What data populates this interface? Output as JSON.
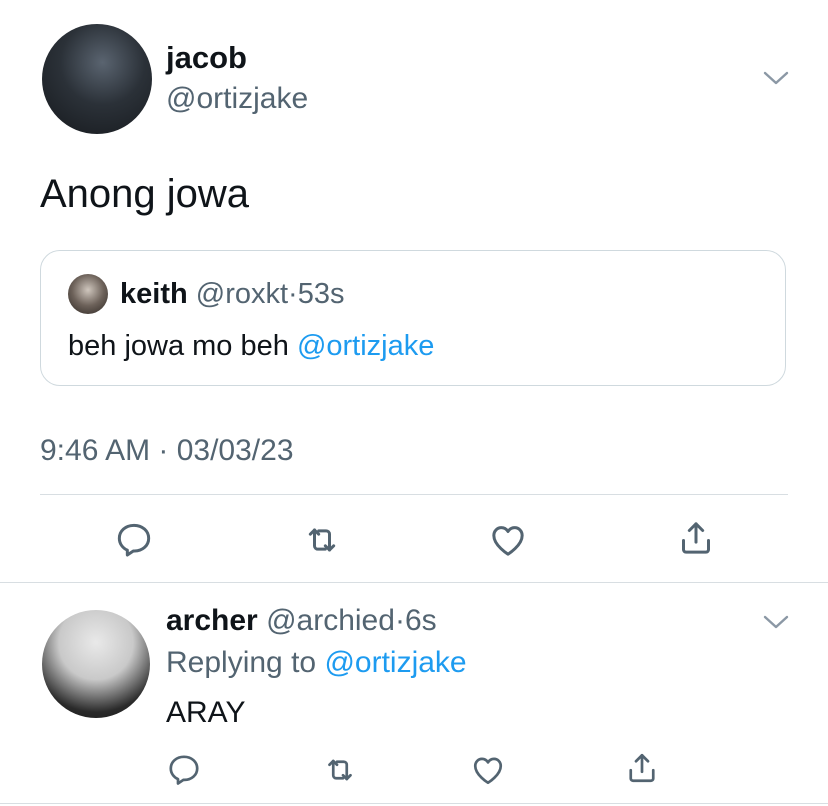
{
  "tweet": {
    "display_name": "jacob",
    "handle": "@ortizjake",
    "text": "Anong jowa",
    "timestamp": "9:46 AM · 03/03/23",
    "quote": {
      "display_name": "keith",
      "handle": "@roxkt",
      "dot": "·",
      "age": "53s",
      "text": "beh jowa mo beh",
      "mention": "@ortizjake"
    }
  },
  "reply": {
    "display_name": "archer",
    "handle": "@archied",
    "dot": "·",
    "age": "6s",
    "replying_to_label": "Replying to",
    "replying_to_handle": "@ortizjake",
    "text": "ARAY"
  },
  "icons": {
    "more": "chevron-down-icon",
    "reply": "reply-icon",
    "retweet": "retweet-icon",
    "like": "heart-icon",
    "share": "share-icon"
  },
  "colors": {
    "text": "#0f1419",
    "secondary": "#536471",
    "link": "#1d9bf0",
    "border": "#cfd9de"
  }
}
